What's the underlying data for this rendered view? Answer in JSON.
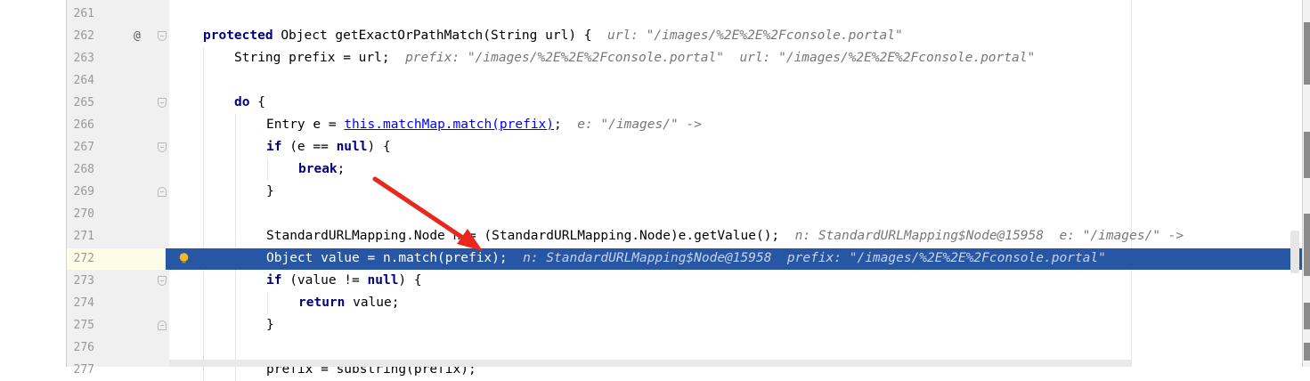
{
  "editor": {
    "lines": [
      {
        "number": "261",
        "code": ""
      },
      {
        "number": "262",
        "marker": "@",
        "code": "protected Object getExactOrPathMatch(String url) {",
        "hint": "url: \"/images/%2E%2E%2Fconsole.portal\""
      },
      {
        "number": "263",
        "code": "String prefix = url;",
        "hint": "prefix: \"/images/%2E%2E%2Fconsole.portal\"  url: \"/images/%2E%2E%2Fconsole.portal\""
      },
      {
        "number": "264",
        "code": ""
      },
      {
        "number": "265",
        "code": "do {"
      },
      {
        "number": "266",
        "code_pre": "Entry e = ",
        "code_link": "this.matchMap.match(prefix)",
        "code_post": ";",
        "hint": "e: \"/images/\" ->"
      },
      {
        "number": "267",
        "code": "if (e == null) {"
      },
      {
        "number": "268",
        "code": "break;"
      },
      {
        "number": "269",
        "code": "}"
      },
      {
        "number": "270",
        "code": ""
      },
      {
        "number": "271",
        "code": "StandardURLMapping.Node n = (StandardURLMapping.Node)e.getValue();",
        "hint": "n: StandardURLMapping$Node@15958  e: \"/images/\" ->"
      },
      {
        "number": "272",
        "code": "Object value = n.match(prefix);",
        "hint": "n: StandardURLMapping$Node@15958  prefix: \"/images/%2E%2E%2Fconsole.portal\""
      },
      {
        "number": "273",
        "code": "if (value != null) {"
      },
      {
        "number": "274",
        "code": "return value;"
      },
      {
        "number": "275",
        "code": "}"
      },
      {
        "number": "276",
        "code": ""
      },
      {
        "number": "277",
        "code": "prefix = substring(prefix);"
      }
    ],
    "current_execution_line": "272"
  },
  "colors": {
    "keyword": "#000080",
    "execution_highlight": "#2756a5",
    "inline_hint": "#787878",
    "annotation_arrow": "#e8281e"
  },
  "icons": {
    "override_marker": "at-sign-icon",
    "intention_bulb": "lightbulb-icon",
    "fold_markers": "fold-icon",
    "annotation": "red-arrow-icon"
  }
}
